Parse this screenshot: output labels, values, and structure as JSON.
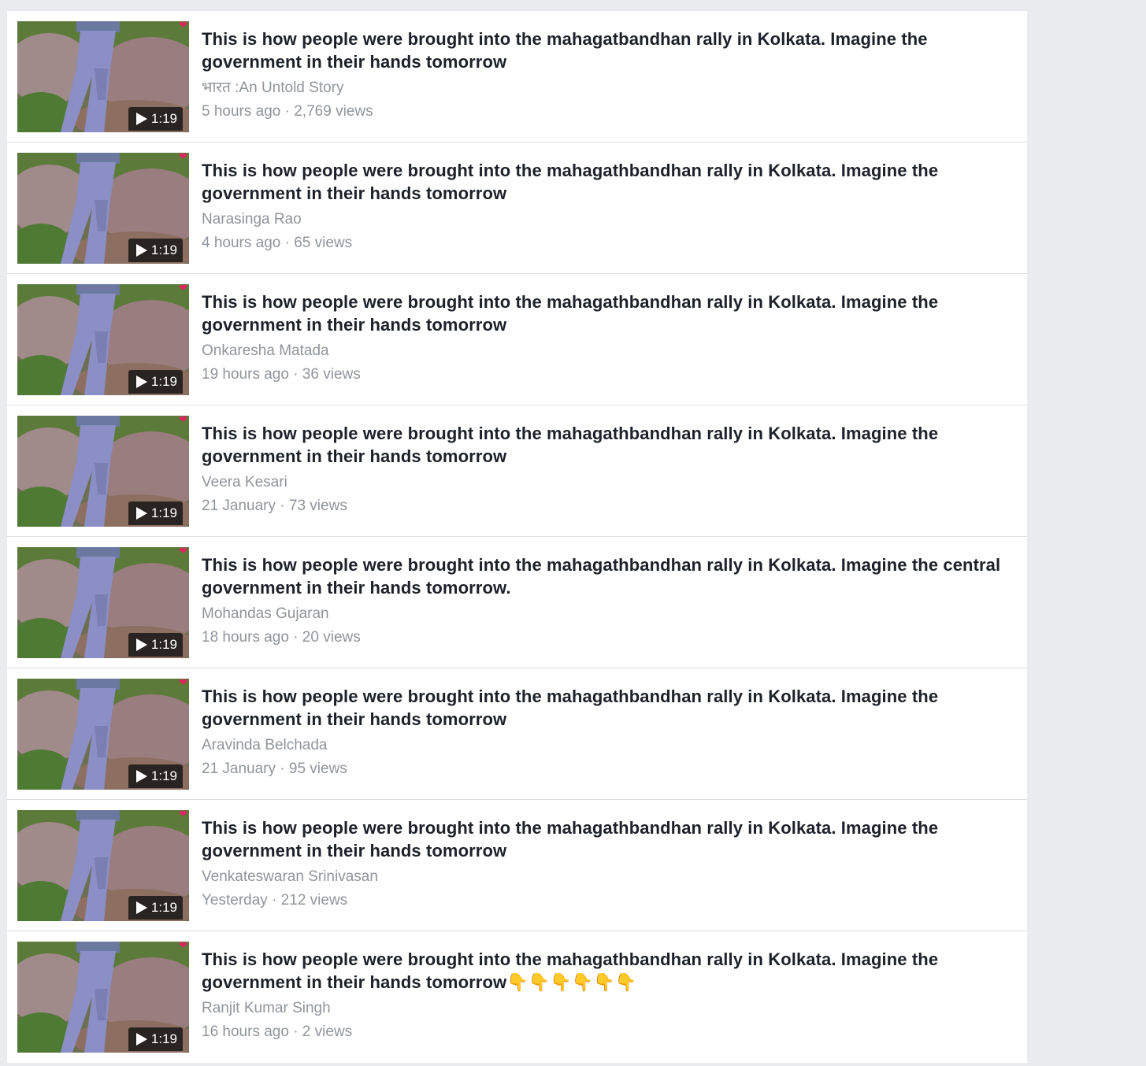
{
  "results": [
    {
      "title": "This is how people were brought into the mahagatbandhan rally in Kolkata. Imagine the government in their hands tomorrow",
      "title_suffix": "",
      "author": "भारत :An Untold Story",
      "meta": "5 hours ago · 2,769 views",
      "duration": "1:19"
    },
    {
      "title": "This is how people were brought into the mahagathbandhan rally in Kolkata. Imagine the government in their hands tomorrow",
      "title_suffix": "",
      "author": "Narasinga Rao",
      "meta": "4 hours ago · 65 views",
      "duration": "1:19"
    },
    {
      "title": "This is how people were brought into the mahagathbandhan rally in Kolkata. Imagine the government in their hands tomorrow",
      "title_suffix": "",
      "author": "Onkaresha Matada",
      "meta": "19 hours ago · 36 views",
      "duration": "1:19"
    },
    {
      "title": "This is how people were brought into the mahagathbandhan rally in Kolkata. Imagine the government in their hands tomorrow",
      "title_suffix": "",
      "author": "Veera Kesari",
      "meta": "21 January · 73 views",
      "duration": "1:19"
    },
    {
      "title": "This is how people were brought into the mahagathbandhan rally in Kolkata. Imagine the central government in their hands tomorrow.",
      "title_suffix": "",
      "author": "Mohandas Gujaran",
      "meta": "18 hours ago · 20 views",
      "duration": "1:19"
    },
    {
      "title": "This is how people were brought into the mahagathbandhan rally in Kolkata. Imagine the government in their hands tomorrow",
      "title_suffix": "",
      "author": "Aravinda Belchada",
      "meta": "21 January · 95 views",
      "duration": "1:19"
    },
    {
      "title": "This is how people were brought into the mahagathbandhan rally in Kolkata. Imagine the government in their hands tomorrow",
      "title_suffix": "",
      "author": "Venkateswaran Srinivasan",
      "meta": "Yesterday · 212 views",
      "duration": "1:19"
    },
    {
      "title": "This is how people were brought into the mahagathbandhan rally in Kolkata. Imagine the government in their hands tomorrow",
      "title_suffix": "👇👇👇👇👇👇",
      "author": "Ranjit Kumar Singh",
      "meta": "16 hours ago · 2 views",
      "duration": "1:19"
    }
  ],
  "colors": {
    "page_background": "#e9ebee",
    "card_background": "#ffffff",
    "title_text": "#1d2129",
    "secondary_text": "#90949c",
    "divider": "#dddfe2"
  },
  "icons": {
    "play": "play-icon",
    "thumbnail_badge": "heart-icon"
  }
}
